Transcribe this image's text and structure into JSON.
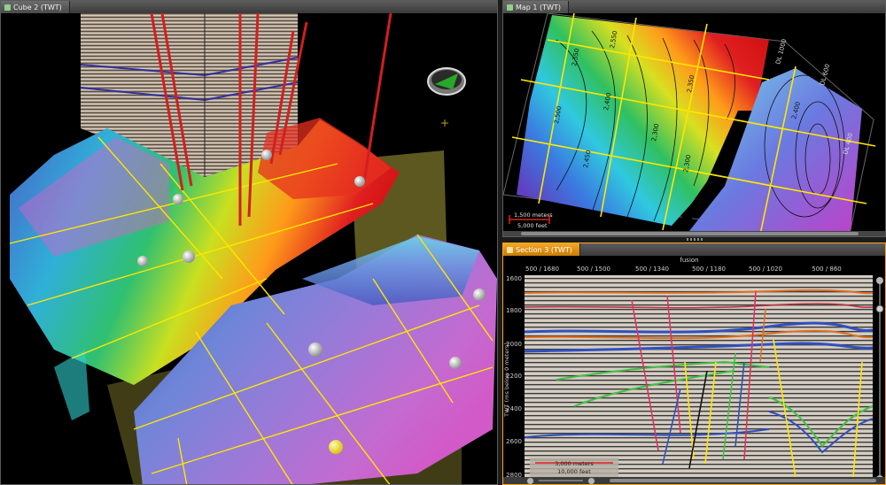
{
  "panes": {
    "cube": {
      "tab_label": "Cube 2 (TWT)"
    },
    "map": {
      "tab_label": "Map 1 (TWT)",
      "contour_labels": [
        "2,350",
        "2,400",
        "2,450",
        "2,500",
        "2,550",
        "2,300",
        "2,350",
        "2,300",
        "2,400"
      ],
      "edge_labels": [
        "DL 1000",
        "DL 600",
        "DL 400"
      ],
      "scale": {
        "metric": "1,500 meters",
        "imperial": "5,000 feet"
      }
    },
    "section": {
      "tab_label": "Section 3 (TWT)",
      "header_title": "fusion",
      "top_ticks": [
        "500 / 1680",
        "500 / 1500",
        "500 / 1340",
        "500 / 1180",
        "500 / 1020",
        "500 / 860"
      ],
      "y_label": "TWT (ms below 0 meters)",
      "y_ticks": [
        "1600",
        "1800",
        "2000",
        "2200",
        "2400",
        "2600",
        "2800"
      ],
      "scale": {
        "metric": "3,000 meters",
        "imperial": "10,000 feet"
      }
    }
  },
  "colors": {
    "accent_tab": "#f5a623",
    "highlight_line": "#ffe600",
    "fault_red": "#d21f1f"
  }
}
